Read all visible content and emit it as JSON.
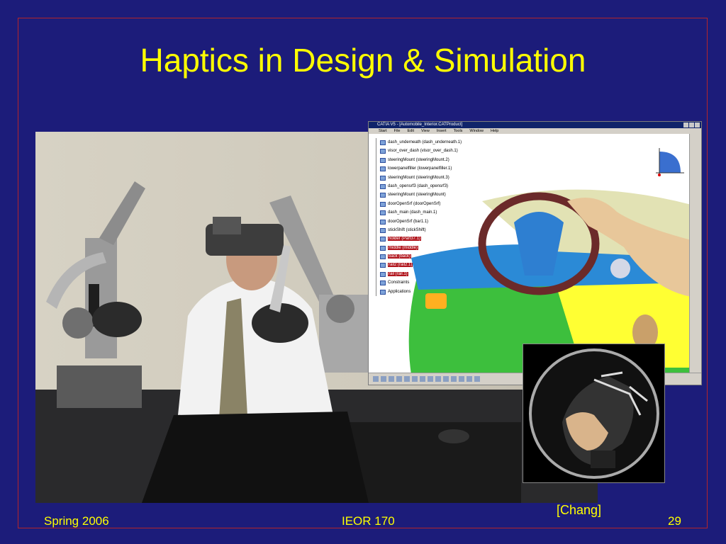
{
  "slide": {
    "title": "Haptics in Design & Simulation",
    "caption": "[Chang]",
    "footer_left": "Spring 2006",
    "footer_center": "IEOR 170",
    "footer_right": "29"
  },
  "catia": {
    "window_title": "CATIA V5 - [Automobile_Interior.CATProduct]",
    "menu": [
      "Start",
      "File",
      "Edit",
      "View",
      "Insert",
      "Tools",
      "Window",
      "Help"
    ],
    "tree": [
      "dash_underneath (dash_underneath.1)",
      "visor_over_dash (visor_over_dash.1)",
      "steeringMount (steeringMount.2)",
      "lowerpanelfiller (lowerpanelfiller.1)",
      "steeringMount (steeringMount.3)",
      "dash_opensrf3 (dash_opensrf3)",
      "steeringMount (steeringMount)",
      "doorOpenSrf (doorOpenSrf)",
      "dash_main (dash_main.1)",
      "doorOpenSrf (bar1.1)",
      "stickShift (stickShift)",
      "holder (Part37.1)",
      "middle (middle)",
      "back (back)",
      "rail2 (rail2.1)",
      "rail (rail.1)",
      "Constraints",
      "Applications"
    ],
    "selected_range": [
      11,
      15
    ]
  },
  "colors": {
    "background": "#1c1c7a",
    "title": "#ffff00",
    "frame": "#b3242b"
  }
}
